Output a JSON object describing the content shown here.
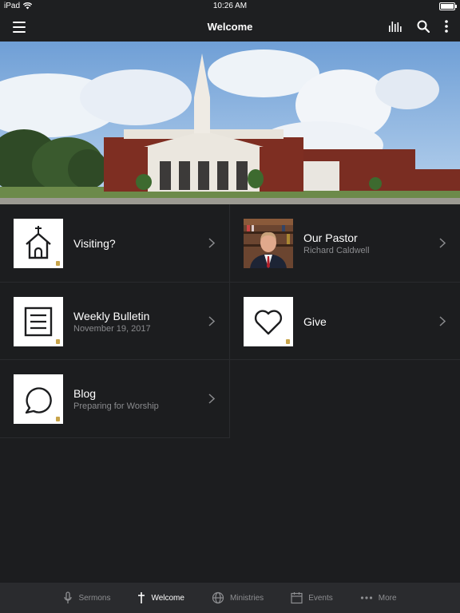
{
  "status": {
    "device": "iPad",
    "time": "10:26 AM"
  },
  "nav": {
    "title": "Welcome"
  },
  "tiles": [
    {
      "title": "Visiting?",
      "subtitle": "",
      "icon": "church-icon"
    },
    {
      "title": "Our Pastor",
      "subtitle": "Richard Caldwell",
      "icon": "pastor-photo"
    },
    {
      "title": "Weekly Bulletin",
      "subtitle": "November 19, 2017",
      "icon": "bulletin-icon"
    },
    {
      "title": "Give",
      "subtitle": "",
      "icon": "heart-icon"
    },
    {
      "title": "Blog",
      "subtitle": "Preparing for Worship",
      "icon": "chat-bubble-icon"
    }
  ],
  "tabs": [
    {
      "label": "Sermons",
      "icon": "microphone-icon"
    },
    {
      "label": "Welcome",
      "icon": "cross-icon"
    },
    {
      "label": "Ministries",
      "icon": "globe-icon"
    },
    {
      "label": "Events",
      "icon": "calendar-icon"
    },
    {
      "label": "More",
      "icon": "ellipsis-icon"
    }
  ],
  "colors": {
    "background": "#1c1d1f",
    "tabbar": "#2a2b2e",
    "subtitle": "#8a8b8e",
    "active_tab": "#ffffff",
    "inactive_tab": "#8e8f92"
  }
}
